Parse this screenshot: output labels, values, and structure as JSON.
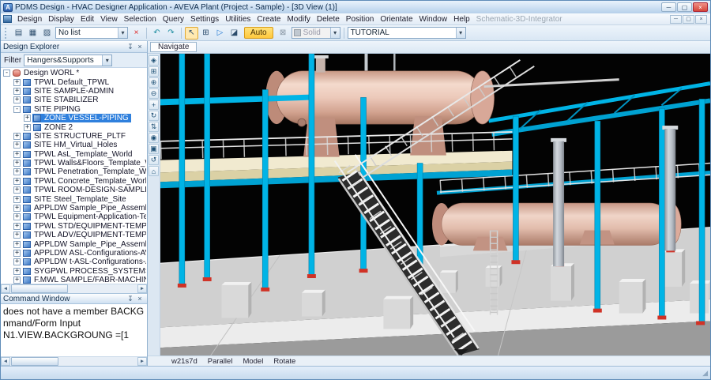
{
  "ui": {
    "dropdown_arrow": "▾",
    "scroll_left": "◄",
    "scroll_right": "►",
    "pin": "↧",
    "small_close": "×",
    "resize_grip": "◢"
  },
  "colors": {
    "structure_cyan": "#00b4e6",
    "vessel_pink": "#e6c0b2",
    "deck_cream": "#f1ead0",
    "selection_blue": "#2f80dd",
    "auto_button": "#ffd54f",
    "viewport_background": "#000000"
  },
  "titlebar": {
    "app_icon": "A",
    "title": "PDMS Design - HVAC Designer Application - AVEVA Plant (Project - Sample) - [3D View (1)]",
    "minimize": "─",
    "maximize": "▢",
    "close": "×"
  },
  "menubar": {
    "items": [
      "Design",
      "Display",
      "Edit",
      "View",
      "Selection",
      "Query",
      "Settings",
      "Utilities",
      "Create",
      "Modify",
      "Delete",
      "Position",
      "Orientate",
      "Window",
      "Help"
    ],
    "disabled_item": "Schematic-3D-Integrator",
    "mdi_minimize": "─",
    "mdi_restore": "▢",
    "mdi_close": "×"
  },
  "toolbar": {
    "group1": [
      {
        "name": "design-data-icon",
        "glyph": "▤"
      },
      {
        "name": "draw-list-icon",
        "glyph": "▦"
      },
      {
        "name": "graphics-settings-icon",
        "glyph": "▨"
      }
    ],
    "no_list_value": "No list",
    "clear_glyph": "×",
    "group2": [
      {
        "name": "undo-icon",
        "glyph": "↶",
        "teal": true
      },
      {
        "name": "redo-icon",
        "glyph": "↷",
        "teal": true
      }
    ],
    "group3": [
      {
        "name": "select-pointer-icon",
        "glyph": "↖",
        "pressed": true
      },
      {
        "name": "zoom-select-icon",
        "glyph": "⊞"
      },
      {
        "name": "walkthrough-icon",
        "glyph": "▷",
        "blue": true
      },
      {
        "name": "clipping-icon",
        "glyph": "◪"
      }
    ],
    "auto_label": "Auto",
    "group4": [
      {
        "name": "lock-icon",
        "glyph": "⊠",
        "gray": true
      }
    ],
    "solid_label": "Solid",
    "view_combo_value": "TUTORIAL"
  },
  "explorer": {
    "title": "Design Explorer",
    "filter_label": "Filter",
    "filter_value": "Hangers&Supports",
    "tree": [
      {
        "level": 0,
        "expand": "-",
        "label": "Design WORL *",
        "root": true
      },
      {
        "level": 1,
        "expand": "+",
        "label": "TPWL Default_TPWL"
      },
      {
        "level": 1,
        "expand": "+",
        "label": "SITE SAMPLE-ADMIN"
      },
      {
        "level": 1,
        "expand": "+",
        "label": "SITE STABILIZER"
      },
      {
        "level": 1,
        "expand": "-",
        "label": "SITE PIPING"
      },
      {
        "level": 2,
        "expand": "+",
        "label": "ZONE VESSEL-PIPING",
        "selected": true
      },
      {
        "level": 2,
        "expand": "+",
        "label": "ZONE 2"
      },
      {
        "level": 1,
        "expand": "+",
        "label": "SITE STRUCTURE_PLTF"
      },
      {
        "level": 1,
        "expand": "+",
        "label": "SITE HM_Virtual_Holes"
      },
      {
        "level": 1,
        "expand": "+",
        "label": "TPWL AsL_Template_World"
      },
      {
        "level": 1,
        "expand": "+",
        "label": "TPWL Walls&Floors_Template_World"
      },
      {
        "level": 1,
        "expand": "+",
        "label": "TPWL Penetration_Template_World"
      },
      {
        "level": 1,
        "expand": "+",
        "label": "TPWL Concrete_Template_World"
      },
      {
        "level": 1,
        "expand": "+",
        "label": "TPWL ROOM-DESIGN-SAMPLE-TEMPLA"
      },
      {
        "level": 1,
        "expand": "+",
        "label": "SITE Steel_Template_Site"
      },
      {
        "level": 1,
        "expand": "+",
        "label": "APPLDW Sample_Pipe_Assemblies"
      },
      {
        "level": 1,
        "expand": "+",
        "label": "TPWL Equipment-Application-Templates"
      },
      {
        "level": 1,
        "expand": "+",
        "label": "TPWL STD/EQUIPMENT-TEMPLATES"
      },
      {
        "level": 1,
        "expand": "+",
        "label": "TPWL ADV/EQUIPMENT-TEMPLATES"
      },
      {
        "level": 1,
        "expand": "+",
        "label": "APPLDW Sample_Pipe_Assemblies"
      },
      {
        "level": 1,
        "expand": "+",
        "label": "APPLDW ASL-Configurations-AVEVA"
      },
      {
        "level": 1,
        "expand": "+",
        "label": "APPLDW t-ASL-Configurations-AVEVA"
      },
      {
        "level": 1,
        "expand": "+",
        "label": "SYGPWL PROCESS_SYSTEMS"
      },
      {
        "level": 1,
        "expand": "+",
        "label": "F.MWL SAMPLE/FABR-MACHINES"
      }
    ]
  },
  "command_window": {
    "title": "Command Window",
    "lines": [
      "does not have a member BACKG",
      "nmand/Form Input",
      "N1.VIEW.BACKGROUNG =[1"
    ]
  },
  "viewport": {
    "tab": "Navigate",
    "tools": [
      {
        "name": "view-all-icon",
        "glyph": "◈"
      },
      {
        "name": "zoom-window-icon",
        "glyph": "⊞"
      },
      {
        "name": "zoom-in-icon",
        "glyph": "⊕"
      },
      {
        "name": "zoom-out-icon",
        "glyph": "⊖"
      },
      {
        "name": "pan-icon",
        "glyph": "+"
      },
      {
        "name": "rotate-view-icon",
        "glyph": "↻"
      },
      {
        "name": "walk-icon",
        "glyph": "⇅"
      },
      {
        "name": "look-at-icon",
        "glyph": "◉"
      },
      {
        "name": "view-limits-icon",
        "glyph": "▣"
      },
      {
        "name": "refresh-view-icon",
        "glyph": "↺"
      },
      {
        "name": "home-view-icon",
        "glyph": "⌂"
      }
    ],
    "status": {
      "view_name": "w21s7d",
      "projection": "Parallel",
      "mode": "Model",
      "action": "Rotate"
    }
  }
}
